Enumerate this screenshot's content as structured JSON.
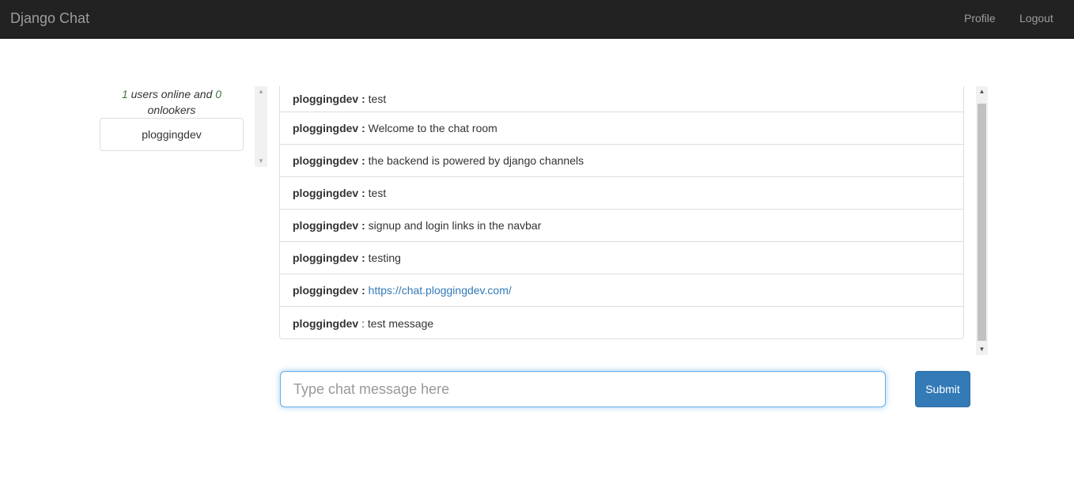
{
  "navbar": {
    "brand": "Django Chat",
    "links": {
      "profile": "Profile",
      "logout": "Logout"
    }
  },
  "users": {
    "online_count": "1",
    "online_text": " users online and ",
    "onlooker_count": "0",
    "onlooker_text": "onlookers",
    "list": [
      "ploggingdev"
    ]
  },
  "messages": [
    {
      "author": "ploggingdev",
      "separator": " : ",
      "text": "test"
    },
    {
      "author": "ploggingdev",
      "separator": " : ",
      "text": "Welcome to the chat room"
    },
    {
      "author": "ploggingdev",
      "separator": " : ",
      "text": "the backend is powered by django channels"
    },
    {
      "author": "ploggingdev",
      "separator": " : ",
      "text": "test"
    },
    {
      "author": "ploggingdev",
      "separator": " : ",
      "text": "signup and login links in the navbar"
    },
    {
      "author": "ploggingdev",
      "separator": " : ",
      "text": "testing"
    },
    {
      "author": "ploggingdev",
      "separator": " : ",
      "text": "https://chat.ploggingdev.com/"
    },
    {
      "author": "ploggingdev",
      "separator": " : ",
      "text": "test message"
    }
  ],
  "composer": {
    "placeholder": "Type chat message here",
    "value": "",
    "submit_label": "Submit"
  },
  "colors": {
    "navbar_bg": "#222222",
    "link": "#337ab7",
    "count": "#3c763d"
  }
}
